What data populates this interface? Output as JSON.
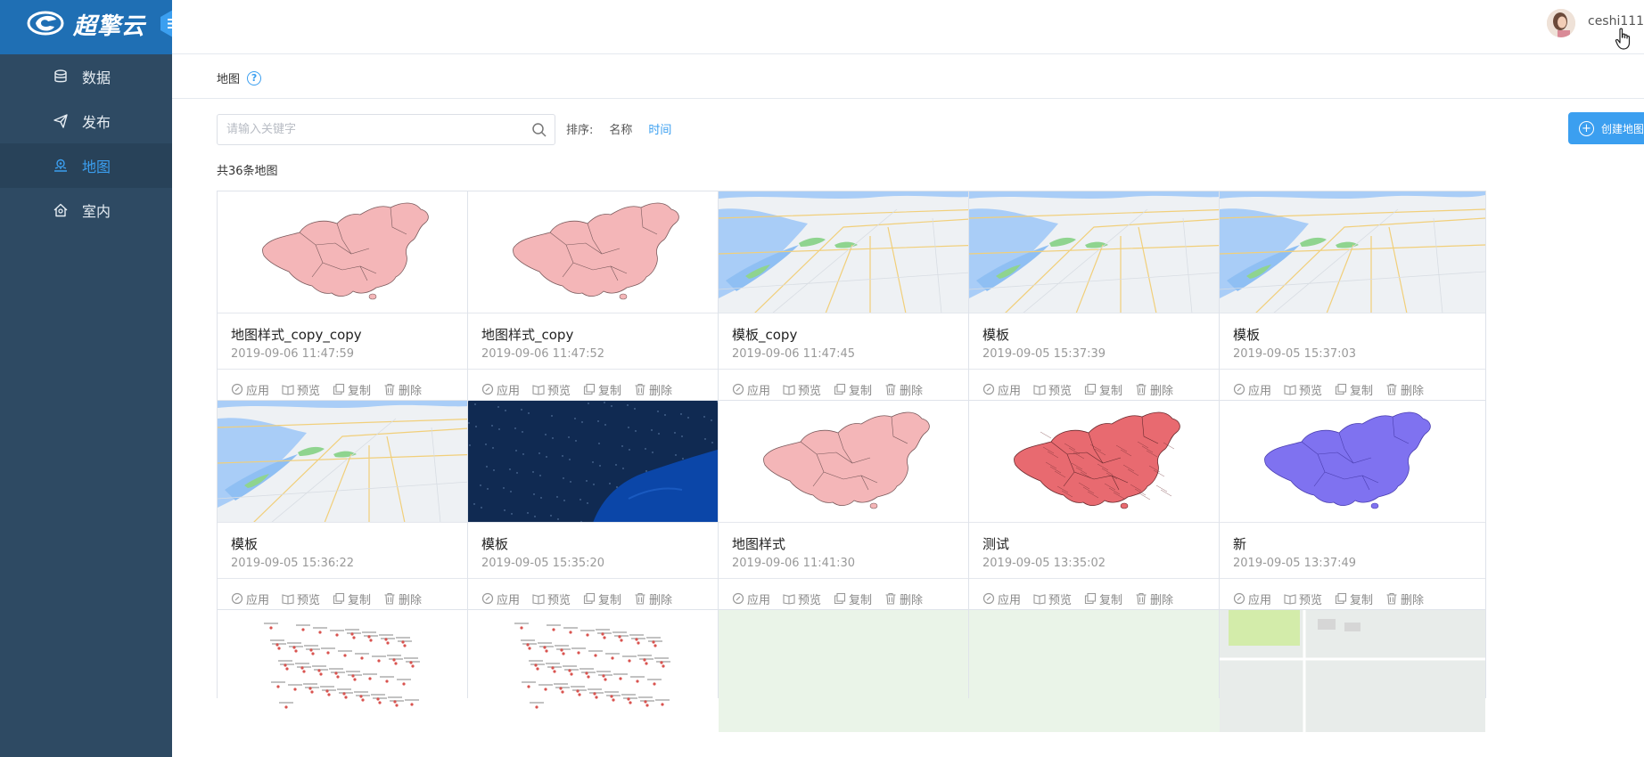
{
  "app": {
    "brand": "超擎云"
  },
  "sidebar": {
    "items": [
      {
        "label": "数据",
        "icon": "database-icon",
        "active": false
      },
      {
        "label": "发布",
        "icon": "send-icon",
        "active": false
      },
      {
        "label": "地图",
        "icon": "map-pin-icon",
        "active": true
      },
      {
        "label": "室内",
        "icon": "indoor-icon",
        "active": false
      }
    ]
  },
  "header": {
    "username": "ceshi111"
  },
  "page": {
    "breadcrumb": "地图",
    "count_text": "共36条地图"
  },
  "search": {
    "placeholder": "请输入关键字"
  },
  "sort": {
    "label": "排序:",
    "options": [
      "名称",
      "时间"
    ],
    "active": "时间"
  },
  "toolbar": {
    "create_label": "创建地图"
  },
  "actions": {
    "apply": "应用",
    "preview": "预览",
    "copy": "复制",
    "delete": "删除"
  },
  "colors": {
    "accent": "#3b9ff0",
    "sidebar": "#2e4a63",
    "logo_bar": "#1f6fb4"
  },
  "cards": [
    {
      "title": "地图样式_copy_copy",
      "date": "2019-09-06 11:47:59",
      "thumb": "china-pink"
    },
    {
      "title": "地图样式_copy",
      "date": "2019-09-06 11:47:52",
      "thumb": "china-pink"
    },
    {
      "title": "模板_copy",
      "date": "2019-09-06 11:47:45",
      "thumb": "street-map"
    },
    {
      "title": "模板",
      "date": "2019-09-05 15:37:39",
      "thumb": "street-map"
    },
    {
      "title": "模板",
      "date": "2019-09-05 15:37:03",
      "thumb": "street-map"
    },
    {
      "title": "模板",
      "date": "2019-09-05 15:36:22",
      "thumb": "street-map"
    },
    {
      "title": "模板",
      "date": "2019-09-05 15:35:20",
      "thumb": "dark-map"
    },
    {
      "title": "地图样式",
      "date": "2019-09-06 11:41:30",
      "thumb": "china-pink"
    },
    {
      "title": "测试",
      "date": "2019-09-05 13:35:02",
      "thumb": "china-red"
    },
    {
      "title": "新",
      "date": "2019-09-05 13:37:49",
      "thumb": "china-purple"
    }
  ],
  "partial_cards": [
    {
      "thumb": "dots-map"
    },
    {
      "thumb": "dots-map"
    },
    {
      "thumb": "light-green"
    },
    {
      "thumb": "light-green"
    },
    {
      "thumb": "green-street"
    }
  ]
}
